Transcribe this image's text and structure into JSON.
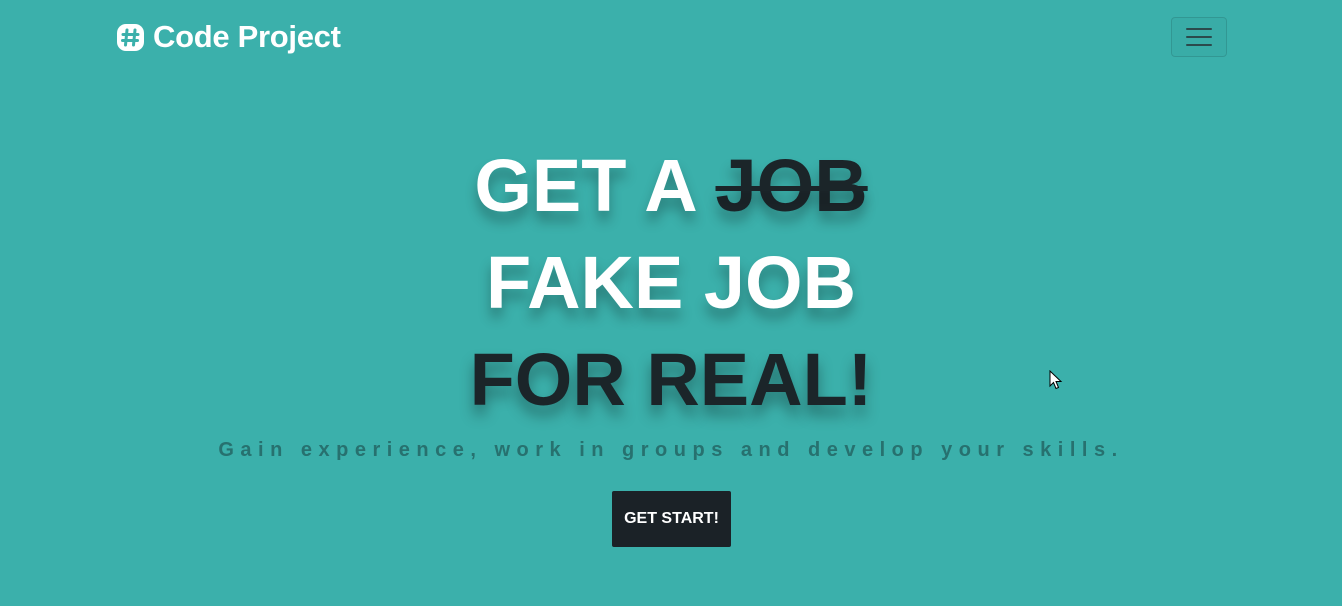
{
  "navbar": {
    "brand_text": "Code Project",
    "brand_icon": "slack-hash-icon",
    "menu_icon": "hamburger-menu-icon"
  },
  "hero": {
    "line1_prefix": "GET A ",
    "line1_strike": "JOB",
    "line2": "FAKE JOB",
    "line3": "FOR REAL!",
    "subtitle": "Gain experience, work in groups and develop your skills.",
    "cta_label": "GET START!"
  },
  "colors": {
    "background": "#3bb0ab",
    "dark": "#1b2227",
    "white": "#ffffff",
    "subtitle": "#27716f"
  }
}
